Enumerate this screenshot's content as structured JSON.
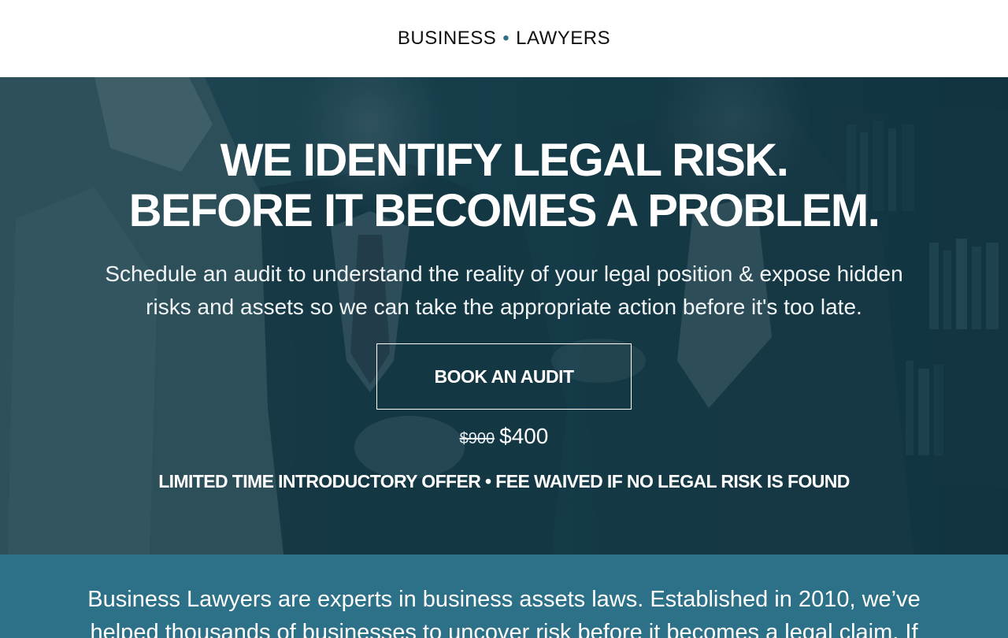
{
  "header": {
    "brand_left": "BUSINESS",
    "brand_separator": "•",
    "brand_right": "LAWYERS"
  },
  "hero": {
    "headline_line1": "WE IDENTIFY LEGAL RISK.",
    "headline_line2": "BEFORE IT BECOMES A PROBLEM.",
    "subtext": "Schedule an audit to understand the reality of your legal position & expose hidden risks and assets so we can take the appropriate action before it's too late.",
    "cta_label": "BOOK AN AUDIT",
    "price_old": "$900",
    "price_new": "$400",
    "offer_text": "LIMITED TIME INTRODUCTORY OFFER • FEE WAIVED IF NO LEGAL RISK IS FOUND"
  },
  "about": {
    "text": "Business Lawyers are experts in business assets laws. Established in 2010, we’ve helped thousands of businesses to uncover risk before it becomes a legal claim. If"
  },
  "colors": {
    "accent": "#2c7187",
    "hero_overlay": "#0f3442",
    "text_dark": "#111111",
    "text_light": "#ffffff"
  }
}
